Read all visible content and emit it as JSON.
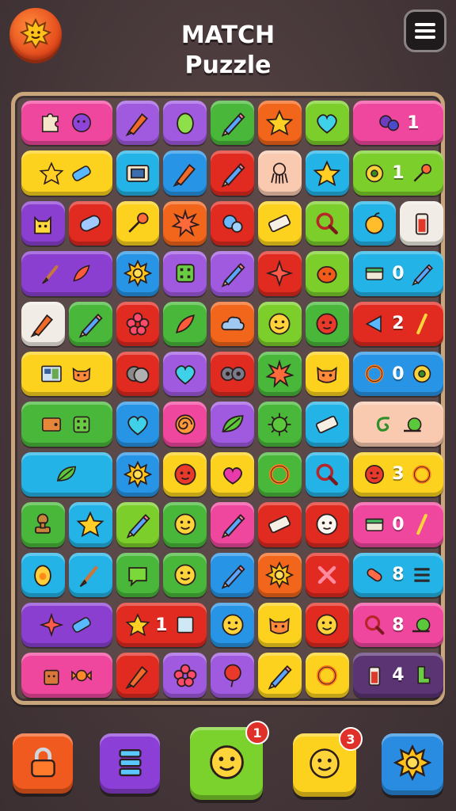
{
  "header": {
    "title_line1": "MATCH",
    "title_line2": "Puzzle",
    "left_icon": "sun-icon",
    "right_icon": "hamburger-menu-icon"
  },
  "colors": {
    "pink": "#f0479e",
    "purple": "#8b3fd1",
    "violet": "#a05ae0",
    "green": "#49b83a",
    "orange": "#f2661c",
    "lime": "#7ccf2b",
    "blue": "#2794e6",
    "cyan": "#23b3e6",
    "red": "#e12a20",
    "yellow": "#fcd21e",
    "peach": "#f9c9b0",
    "white": "#f1ede6",
    "teal": "#15c3c3",
    "darkpurple": "#5b3474"
  },
  "board": {
    "rows": [
      [
        {
          "span": 2,
          "color": "pink",
          "icons": [
            "puzzle-piece-icon",
            "purple-blob-icon"
          ],
          "label": ""
        },
        {
          "span": 1,
          "color": "violet",
          "icons": [
            "crayon-icon"
          ],
          "label": ""
        },
        {
          "span": 1,
          "color": "violet",
          "icons": [
            "leaf-blob-icon"
          ],
          "label": ""
        },
        {
          "span": 1,
          "color": "green",
          "icons": [
            "pencil-icon"
          ],
          "label": ""
        },
        {
          "span": 1,
          "color": "orange",
          "icons": [
            "star-icon"
          ],
          "label": ""
        },
        {
          "span": 1,
          "color": "lime",
          "icons": [
            "heart-icon"
          ],
          "label": ""
        },
        {
          "span": 2,
          "color": "pink",
          "icons": [
            "blob-cluster-icon"
          ],
          "label": "1"
        }
      ],
      [
        {
          "span": 2,
          "color": "yellow",
          "icons": [
            "star-icon",
            "tape-icon"
          ],
          "label": ""
        },
        {
          "span": 1,
          "color": "cyan",
          "icons": [
            "film-icon"
          ],
          "label": ""
        },
        {
          "span": 1,
          "color": "blue",
          "icons": [
            "crayon-icon"
          ],
          "label": ""
        },
        {
          "span": 1,
          "color": "red",
          "icons": [
            "pencil-icon"
          ],
          "label": ""
        },
        {
          "span": 1,
          "color": "peach",
          "icons": [
            "octopus-icon"
          ],
          "label": ""
        },
        {
          "span": 1,
          "color": "cyan",
          "icons": [
            "star-icon"
          ],
          "label": ""
        },
        {
          "span": 2,
          "color": "lime",
          "icons": [
            "donut-icon",
            "pin-icon"
          ],
          "label": "1"
        }
      ],
      [
        {
          "span": 1,
          "color": "purple",
          "icons": [
            "cat-icon"
          ],
          "label": ""
        },
        {
          "span": 1,
          "color": "red",
          "icons": [
            "roll-icon"
          ],
          "label": ""
        },
        {
          "span": 1,
          "color": "yellow",
          "icons": [
            "pin-icon"
          ],
          "label": ""
        },
        {
          "span": 1,
          "color": "orange",
          "icons": [
            "starburst-icon"
          ],
          "label": ""
        },
        {
          "span": 1,
          "color": "red",
          "icons": [
            "bubbles-icon"
          ],
          "label": ""
        },
        {
          "span": 1,
          "color": "yellow",
          "icons": [
            "eraser-icon"
          ],
          "label": ""
        },
        {
          "span": 1,
          "color": "lime",
          "icons": [
            "magnifier-icon"
          ],
          "label": ""
        },
        {
          "span": 1,
          "color": "cyan",
          "icons": [
            "apple-icon"
          ],
          "label": ""
        },
        {
          "span": 1,
          "color": "white",
          "icons": [
            "battery-icon"
          ],
          "label": ""
        }
      ],
      [
        {
          "span": 2,
          "color": "purple",
          "icons": [
            "brush-icon",
            "feather-icon"
          ],
          "label": ""
        },
        {
          "span": 1,
          "color": "blue",
          "icons": [
            "sun-icon"
          ],
          "label": ""
        },
        {
          "span": 1,
          "color": "violet",
          "icons": [
            "dice-icon"
          ],
          "label": ""
        },
        {
          "span": 1,
          "color": "violet",
          "icons": [
            "pencil-icon"
          ],
          "label": ""
        },
        {
          "span": 1,
          "color": "red",
          "icons": [
            "sparkle-icon"
          ],
          "label": ""
        },
        {
          "span": 1,
          "color": "lime",
          "icons": [
            "pumpkin-icon"
          ],
          "label": ""
        },
        {
          "span": 2,
          "color": "cyan",
          "icons": [
            "box-icon",
            "pencil-icon"
          ],
          "label": "0"
        }
      ],
      [
        {
          "span": 1,
          "color": "white",
          "icons": [
            "crayon-icon"
          ],
          "label": ""
        },
        {
          "span": 1,
          "color": "green",
          "icons": [
            "pencil-icon"
          ],
          "label": ""
        },
        {
          "span": 1,
          "color": "red",
          "icons": [
            "flower-icon"
          ],
          "label": ""
        },
        {
          "span": 1,
          "color": "green",
          "icons": [
            "feather-icon"
          ],
          "label": ""
        },
        {
          "span": 1,
          "color": "orange",
          "icons": [
            "cloud-icon"
          ],
          "label": ""
        },
        {
          "span": 1,
          "color": "lime",
          "icons": [
            "smiley-icon"
          ],
          "label": ""
        },
        {
          "span": 1,
          "color": "green",
          "icons": [
            "red-face-icon"
          ],
          "label": ""
        },
        {
          "span": 2,
          "color": "red",
          "icons": [
            "play-left-icon",
            "slash-icon"
          ],
          "label": "2"
        }
      ],
      [
        {
          "span": 2,
          "color": "yellow",
          "icons": [
            "map-icon",
            "cat-face-icon"
          ],
          "label": ""
        },
        {
          "span": 1,
          "color": "red",
          "icons": [
            "coins-icon"
          ],
          "label": ""
        },
        {
          "span": 1,
          "color": "violet",
          "icons": [
            "heart-icon"
          ],
          "label": ""
        },
        {
          "span": 1,
          "color": "red",
          "icons": [
            "eyes-icon"
          ],
          "label": ""
        },
        {
          "span": 1,
          "color": "green",
          "icons": [
            "starburst-icon"
          ],
          "label": ""
        },
        {
          "span": 1,
          "color": "yellow",
          "icons": [
            "cat-face-icon"
          ],
          "label": ""
        },
        {
          "span": 2,
          "color": "blue",
          "icons": [
            "ring-icon",
            "donut-icon"
          ],
          "label": "0"
        }
      ],
      [
        {
          "span": 2,
          "color": "green",
          "icons": [
            "wallet-icon",
            "dice-icon"
          ],
          "label": ""
        },
        {
          "span": 1,
          "color": "blue",
          "icons": [
            "heart-icon"
          ],
          "label": ""
        },
        {
          "span": 1,
          "color": "pink",
          "icons": [
            "spiral-icon"
          ],
          "label": ""
        },
        {
          "span": 1,
          "color": "violet",
          "icons": [
            "leaf-icon"
          ],
          "label": ""
        },
        {
          "span": 1,
          "color": "green",
          "icons": [
            "virus-icon"
          ],
          "label": ""
        },
        {
          "span": 1,
          "color": "cyan",
          "icons": [
            "eraser-icon"
          ],
          "label": ""
        },
        {
          "span": 2,
          "color": "peach",
          "icons": [
            "swirl-icon",
            "snail-icon"
          ],
          "label": ""
        }
      ],
      [
        {
          "span": 2,
          "color": "cyan",
          "icons": [
            "leaf-icon"
          ],
          "label": ""
        },
        {
          "span": 1,
          "color": "blue",
          "icons": [
            "sun-icon"
          ],
          "label": ""
        },
        {
          "span": 1,
          "color": "yellow",
          "icons": [
            "red-face-icon"
          ],
          "label": ""
        },
        {
          "span": 1,
          "color": "yellow",
          "icons": [
            "heart-blob-icon"
          ],
          "label": ""
        },
        {
          "span": 1,
          "color": "green",
          "icons": [
            "ring-icon"
          ],
          "label": ""
        },
        {
          "span": 1,
          "color": "cyan",
          "icons": [
            "magnifier-icon"
          ],
          "label": ""
        },
        {
          "span": 2,
          "color": "yellow",
          "icons": [
            "red-face-icon",
            "ring-icon"
          ],
          "label": "3"
        }
      ],
      [
        {
          "span": 1,
          "color": "green",
          "icons": [
            "stamp-icon"
          ],
          "label": ""
        },
        {
          "span": 1,
          "color": "cyan",
          "icons": [
            "star-icon"
          ],
          "label": ""
        },
        {
          "span": 1,
          "color": "lime",
          "icons": [
            "pencil-icon"
          ],
          "label": ""
        },
        {
          "span": 1,
          "color": "green",
          "icons": [
            "smiley-icon"
          ],
          "label": ""
        },
        {
          "span": 1,
          "color": "pink",
          "icons": [
            "pencil-icon"
          ],
          "label": ""
        },
        {
          "span": 1,
          "color": "red",
          "icons": [
            "eraser-icon"
          ],
          "label": ""
        },
        {
          "span": 1,
          "color": "red",
          "icons": [
            "white-face-icon"
          ],
          "label": ""
        },
        {
          "span": 2,
          "color": "pink",
          "icons": [
            "box-icon",
            "slash-icon"
          ],
          "label": "0"
        }
      ],
      [
        {
          "span": 1,
          "color": "cyan",
          "icons": [
            "egg-icon"
          ],
          "label": ""
        },
        {
          "span": 1,
          "color": "cyan",
          "icons": [
            "brush-icon"
          ],
          "label": ""
        },
        {
          "span": 1,
          "color": "green",
          "icons": [
            "speech-bubble-icon"
          ],
          "label": ""
        },
        {
          "span": 1,
          "color": "green",
          "icons": [
            "smiley-icon"
          ],
          "label": ""
        },
        {
          "span": 1,
          "color": "blue",
          "icons": [
            "pencil-icon"
          ],
          "label": ""
        },
        {
          "span": 1,
          "color": "orange",
          "icons": [
            "sun-icon"
          ],
          "label": ""
        },
        {
          "span": 1,
          "color": "red",
          "icons": [
            "cross-icon"
          ],
          "label": ""
        },
        {
          "span": 2,
          "color": "cyan",
          "icons": [
            "tube-icon",
            "list-icon"
          ],
          "label": "8"
        }
      ],
      [
        {
          "span": 2,
          "color": "purple",
          "icons": [
            "sparkle-icon",
            "tape-icon"
          ],
          "label": ""
        },
        {
          "span": 2,
          "color": "red",
          "icons": [
            "star-icon",
            "square-icon"
          ],
          "label": "1"
        },
        {
          "span": 1,
          "color": "blue",
          "icons": [
            "smiley-icon"
          ],
          "label": ""
        },
        {
          "span": 1,
          "color": "yellow",
          "icons": [
            "cat-face-icon"
          ],
          "label": ""
        },
        {
          "span": 1,
          "color": "red",
          "icons": [
            "smiley-icon"
          ],
          "label": ""
        },
        {
          "span": 2,
          "color": "pink",
          "icons": [
            "magnifier-icon",
            "snail-icon"
          ],
          "label": "8"
        }
      ],
      [
        {
          "span": 2,
          "color": "pink",
          "icons": [
            "bag-icon",
            "candy-icon"
          ],
          "label": ""
        },
        {
          "span": 1,
          "color": "red",
          "icons": [
            "crayon-icon"
          ],
          "label": ""
        },
        {
          "span": 1,
          "color": "violet",
          "icons": [
            "flower-icon"
          ],
          "label": ""
        },
        {
          "span": 1,
          "color": "violet",
          "icons": [
            "balloon-icon"
          ],
          "label": ""
        },
        {
          "span": 1,
          "color": "yellow",
          "icons": [
            "pencil-icon"
          ],
          "label": ""
        },
        {
          "span": 1,
          "color": "yellow",
          "icons": [
            "ring-icon"
          ],
          "label": ""
        },
        {
          "span": 2,
          "color": "darkpurple",
          "icons": [
            "battery-icon",
            "boot-icon"
          ],
          "label": "4"
        }
      ]
    ]
  },
  "bottom": {
    "buttons": [
      {
        "name": "lock-booster-button",
        "icon": "lock-icon",
        "color": "#f05a1e",
        "badge": ""
      },
      {
        "name": "shuffle-booster-button",
        "icon": "stack-icon",
        "color": "#8c3fd6",
        "badge": ""
      },
      {
        "name": "hint-booster-button",
        "icon": "smiley-icon",
        "color": "#7cd22c",
        "badge": "1"
      },
      {
        "name": "chat-booster-button",
        "icon": "smiley-icon",
        "color": "#fcd21e",
        "badge": "3"
      },
      {
        "name": "sun-booster-button",
        "icon": "sun-icon",
        "color": "#2a8ce0",
        "badge": ""
      }
    ]
  }
}
